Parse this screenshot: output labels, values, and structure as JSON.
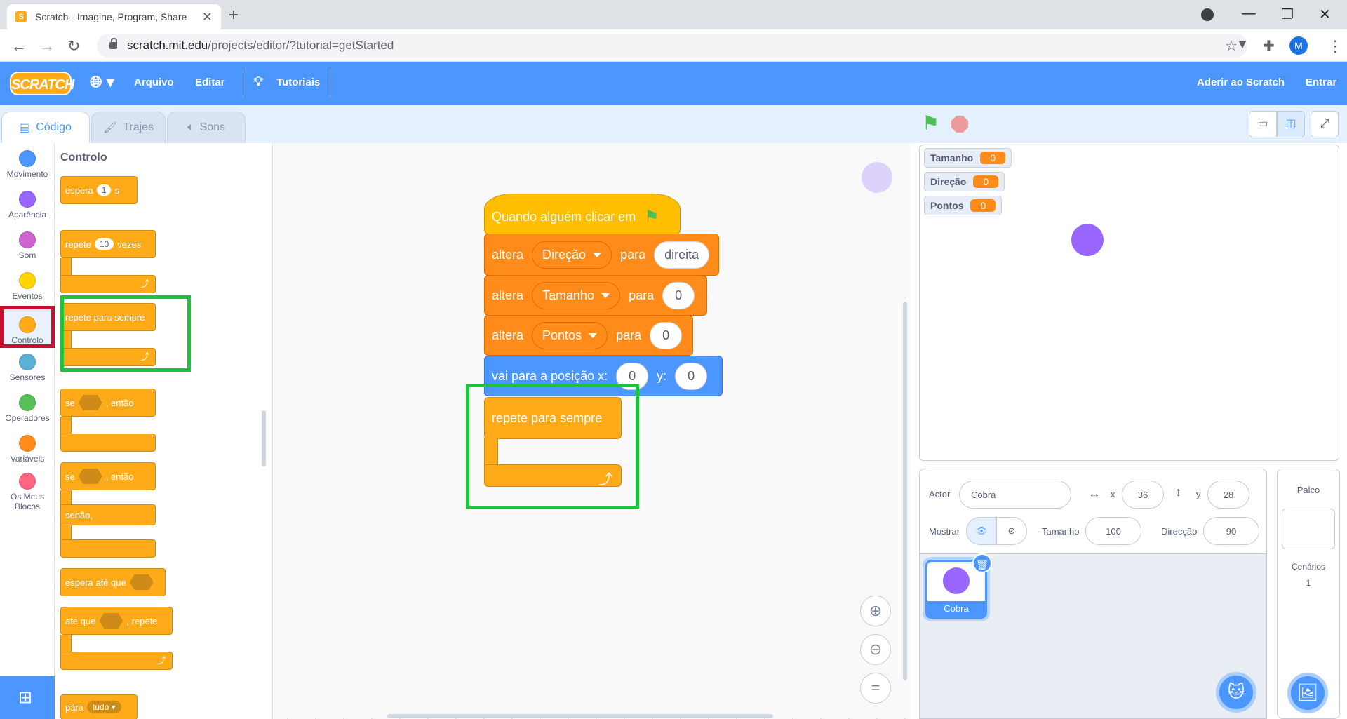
{
  "browser": {
    "tab_title": "Scratch - Imagine, Program, Share",
    "url_host": "scratch.mit.edu",
    "url_path": "/projects/editor/?tutorial=getStarted",
    "profile_initial": "M"
  },
  "menubar": {
    "logo": "SCRATCH",
    "file": "Arquivo",
    "edit": "Editar",
    "tutorials": "Tutoriais",
    "join": "Aderir ao Scratch",
    "signin": "Entrar"
  },
  "tabs": [
    "Código",
    "Trajes",
    "Sons"
  ],
  "categories": [
    {
      "label": "Movimento",
      "color": "#4c97ff"
    },
    {
      "label": "Aparência",
      "color": "#9966ff"
    },
    {
      "label": "Som",
      "color": "#cf63cf"
    },
    {
      "label": "Eventos",
      "color": "#ffd500"
    },
    {
      "label": "Controlo",
      "color": "#ffab19"
    },
    {
      "label": "Sensores",
      "color": "#5cb1d6"
    },
    {
      "label": "Operadores",
      "color": "#59c059"
    },
    {
      "label": "Variáveis",
      "color": "#ff8c1a"
    },
    {
      "label": "Os Meus",
      "label2": "Blocos",
      "color": "#ff6680"
    }
  ],
  "palette": {
    "heading": "Controlo",
    "wait": {
      "a": "espera",
      "n": "1",
      "b": "s"
    },
    "repeat": {
      "a": "repete",
      "n": "10",
      "b": "vezes"
    },
    "forever": "repete para sempre",
    "if_then": {
      "a": "se",
      "b": ", então"
    },
    "if_else": {
      "a": "se",
      "b": ", então",
      "c": "senão,"
    },
    "wait_until": "espera até que",
    "repeat_until": {
      "a": "até que",
      "b": ", repete"
    },
    "stop": {
      "a": "pára",
      "b": "tudo"
    }
  },
  "script": {
    "hat": "Quando alguém clicar em",
    "set1": {
      "verb": "altera",
      "var": "Direção",
      "to": "para",
      "val": "direita"
    },
    "set2": {
      "verb": "altera",
      "var": "Tamanho",
      "to": "para",
      "val": "0"
    },
    "set3": {
      "verb": "altera",
      "var": "Pontos",
      "to": "para",
      "val": "0"
    },
    "goto": {
      "a": "vai para a posição x:",
      "x": "0",
      "b": "y:",
      "y": "0"
    },
    "forever": "repete para sempre"
  },
  "monitors": [
    {
      "name": "Tamanho",
      "value": "0"
    },
    {
      "name": "Direção",
      "value": "0"
    },
    {
      "name": "Pontos",
      "value": "0"
    }
  ],
  "sprite_info": {
    "actor_label": "Actor",
    "actor_name": "Cobra",
    "x_label": "x",
    "x": "36",
    "y_label": "y",
    "y": "28",
    "show_label": "Mostrar",
    "size_label": "Tamanho",
    "size": "100",
    "dir_label": "Direcção",
    "dir": "90"
  },
  "sprites": [
    {
      "name": "Cobra"
    }
  ],
  "stage_panel": {
    "title": "Palco",
    "backdrops_label": "Cenários",
    "backdrops_count": "1"
  },
  "colors": {
    "accent": "#4c97ff",
    "highlight_red": "#c8102e",
    "highlight_green": "#1fc23b",
    "sprite_purple": "#9966ff"
  }
}
